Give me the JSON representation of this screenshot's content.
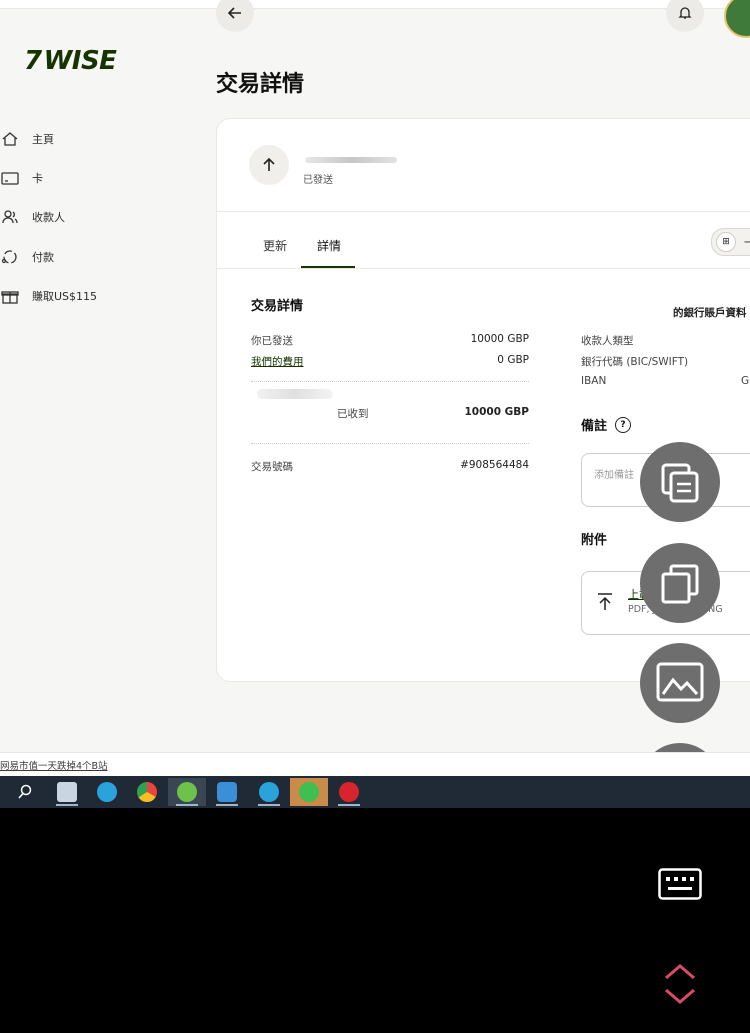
{
  "header": {
    "logo": "WISE",
    "page_title": "交易詳情"
  },
  "sidebar": {
    "items": [
      {
        "label": "主頁",
        "icon": "home-icon"
      },
      {
        "label": "卡",
        "icon": "card-icon"
      },
      {
        "label": "收款人",
        "icon": "recipients-icon"
      },
      {
        "label": "付款",
        "icon": "payments-icon"
      },
      {
        "label": "賺取US$115",
        "icon": "gift-icon"
      }
    ]
  },
  "transfer": {
    "status": "已發送"
  },
  "tabs": [
    {
      "label": "更新",
      "active": false
    },
    {
      "label": "詳情",
      "active": true
    }
  ],
  "toggle": {
    "label": "一"
  },
  "details": {
    "title": "交易詳情",
    "you_sent_label": "你已發送",
    "you_sent_value": "10000 GBP",
    "fee_label": "我們的費用",
    "fee_value": "0 GBP",
    "received_label": "已收到",
    "received_value": "10000 GBP",
    "reference_label": "交易號碼",
    "reference_value": "#908564484"
  },
  "recipient_bank": {
    "title": "的銀行賬戶資料",
    "type_label": "收款人類型",
    "bic_label": "銀行代碼 (BIC/SWIFT)",
    "iban_label": "IBAN",
    "iban_value": "GI"
  },
  "notes": {
    "title": "備註",
    "placeholder": "添加備註"
  },
  "attachments": {
    "title": "附件",
    "upload_label": "上載檔案",
    "formats": "PDF, JPG, JPEG, PNG"
  },
  "footer": {
    "link_text": "网易市值一天跌掉4个B站"
  },
  "colors": {
    "brand": "#163300",
    "taskbar": "#1f2a36",
    "fab": "#6e6e6e"
  }
}
